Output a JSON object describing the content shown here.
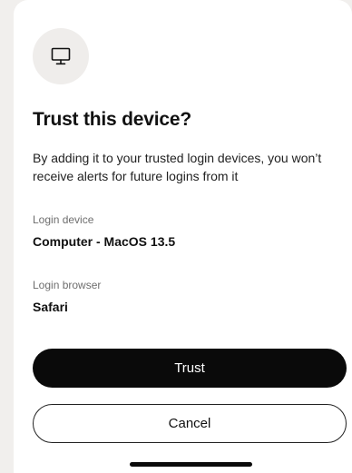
{
  "dialog": {
    "icon": "computer-monitor-icon",
    "title": "Trust this device?",
    "description": "By adding it to your trusted login devices, you won’t receive alerts for future logins from it",
    "fields": [
      {
        "label": "Login device",
        "value": "Computer - MacOS 13.5"
      },
      {
        "label": "Login browser",
        "value": "Safari"
      }
    ],
    "actions": {
      "trust_label": "Trust",
      "cancel_label": "Cancel"
    }
  },
  "colors": {
    "background": "#f1efed",
    "sheet": "#ffffff",
    "icon_circle": "#efedeb",
    "primary_button": "#0a0a0a",
    "muted_text": "#6e6e6e"
  }
}
